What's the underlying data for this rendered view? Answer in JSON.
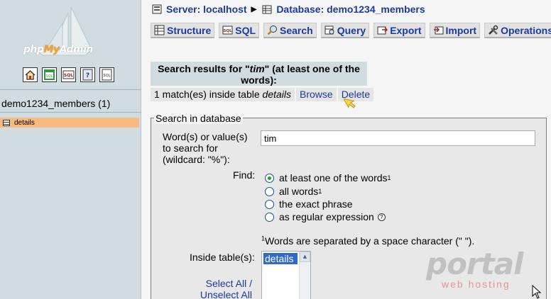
{
  "nav": {
    "logo_prefix": "php",
    "logo_my": "My",
    "logo_suffix": "Admin",
    "icons": [
      "home-icon",
      "query-window-icon",
      "sql-icon",
      "help-icon",
      "docs-icon"
    ],
    "database": "demo1234_members (1)",
    "tables": [
      {
        "label": "details"
      }
    ]
  },
  "breadcrumb": {
    "server_label": "Server: localhost",
    "database_label": "Database: demo1234_members"
  },
  "tabs": [
    {
      "label": "Structure",
      "icon": "structure-icon"
    },
    {
      "label": "SQL",
      "icon": "sql-icon"
    },
    {
      "label": "Search",
      "icon": "search-icon"
    },
    {
      "label": "Query",
      "icon": "query-icon"
    },
    {
      "label": "Export",
      "icon": "export-icon"
    },
    {
      "label": "Import",
      "icon": "import-icon"
    },
    {
      "label": "Operations",
      "icon": "operations-icon"
    }
  ],
  "results": {
    "heading_prefix": "Search results for \"",
    "term": "tim",
    "heading_suffix": "\" (at least one of the words):",
    "match_prefix": "1 match(es) inside table ",
    "match_table": "details",
    "browse_label": "Browse",
    "delete_label": "Delete"
  },
  "form": {
    "legend": "Search in database",
    "words_label": "Word(s) or value(s) to search for (wildcard: \"%\"):",
    "words_value": "tim",
    "find_label": "Find:",
    "options": [
      {
        "label": "at least one of the words",
        "sup": "1",
        "selected": true
      },
      {
        "label": "all words",
        "sup": "1",
        "selected": false
      },
      {
        "label": "the exact phrase",
        "sup": "",
        "selected": false
      },
      {
        "label": "as regular expression",
        "sup": "",
        "selected": false
      }
    ],
    "footnote_sup": "1",
    "footnote": "Words are separated by a space character (\" \").",
    "inside_label": "Inside table(s):",
    "tables_options": [
      "details"
    ],
    "select_all_label": "Select All",
    "slash": " / ",
    "unselect_all_label": "Unselect All"
  },
  "watermark": {
    "brand": "portal",
    "sub": "web hosting"
  },
  "colors": {
    "link": "#1a3aa0",
    "nav_bg": "#d0dce0",
    "selected_table_bg": "#f7ba83"
  }
}
